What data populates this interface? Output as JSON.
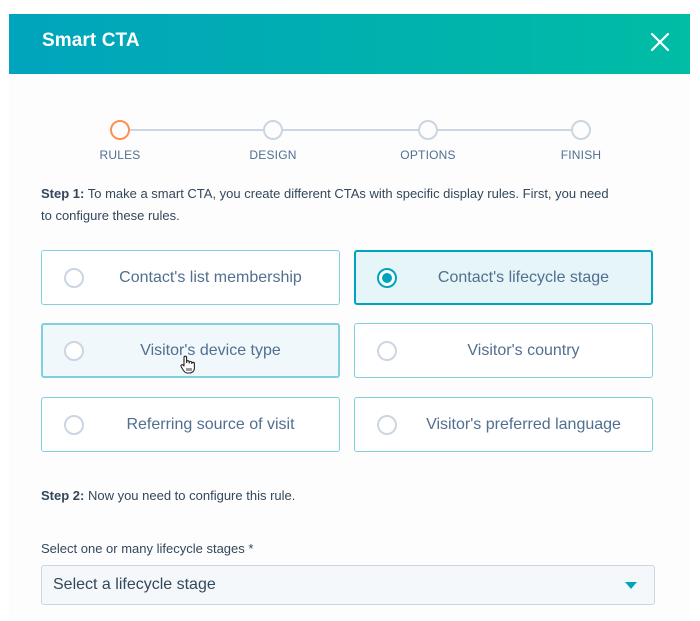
{
  "header": {
    "title": "Smart CTA",
    "close_icon": "close-icon"
  },
  "stepper": {
    "steps": [
      {
        "label": "RULES",
        "state": "active"
      },
      {
        "label": "DESIGN",
        "state": "upcoming"
      },
      {
        "label": "OPTIONS",
        "state": "upcoming"
      },
      {
        "label": "FINISH",
        "state": "upcoming"
      }
    ]
  },
  "step1": {
    "prefix": "Step 1:",
    "line1": " To make a smart CTA, you create different CTAs with specific display rules. First, you need",
    "line2": "to configure these rules."
  },
  "rules": {
    "options": [
      {
        "label": "Contact's list membership",
        "selected": false
      },
      {
        "label": "Contact's lifecycle stage",
        "selected": true
      },
      {
        "label": "Visitor's device type",
        "selected": false,
        "hovered": true
      },
      {
        "label": "Visitor's country",
        "selected": false
      },
      {
        "label": "Referring source of visit",
        "selected": false
      },
      {
        "label": "Visitor's preferred language",
        "selected": false
      }
    ]
  },
  "step2": {
    "prefix": "Step 2:",
    "text": " Now you need to configure this rule."
  },
  "lifecycle_field": {
    "label": "Select one or many lifecycle stages *",
    "placeholder": "Select a lifecycle stage",
    "value": ""
  },
  "colors": {
    "header_start": "#00a4bd",
    "header_end": "#00bda5",
    "accent": "#00a4bd",
    "active_step": "#ff8f59"
  }
}
